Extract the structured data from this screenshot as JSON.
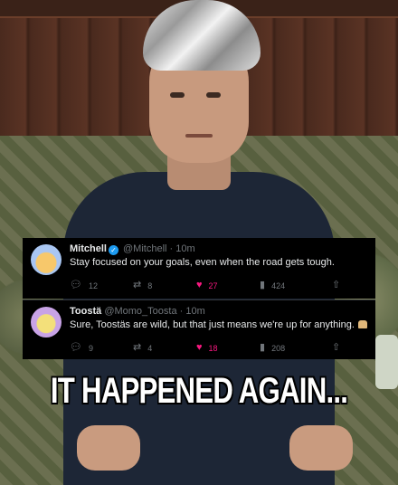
{
  "tweets": [
    {
      "name": "Mitchell",
      "handle": "@Mitchell",
      "time": "· 10m",
      "text": "Stay focused on your goals, even when the road gets tough.",
      "replies": "12",
      "retweets": "8",
      "likes": "27",
      "views": "424",
      "verified": true
    },
    {
      "name": "Toostä",
      "handle": "@Momo_Toosta",
      "time": "· 10m",
      "text": "Sure, Toostäs are wild, but that just means we're up for anything.",
      "replies": "9",
      "retweets": "4",
      "likes": "18",
      "views": "208",
      "verified": false
    }
  ],
  "caption": "IT HAPPENED AGAIN...",
  "colors": {
    "tweet_bg": "#000000",
    "text": "#e7e9ea",
    "muted": "#71767b",
    "like": "#f91880",
    "verified": "#1d9bf0"
  }
}
